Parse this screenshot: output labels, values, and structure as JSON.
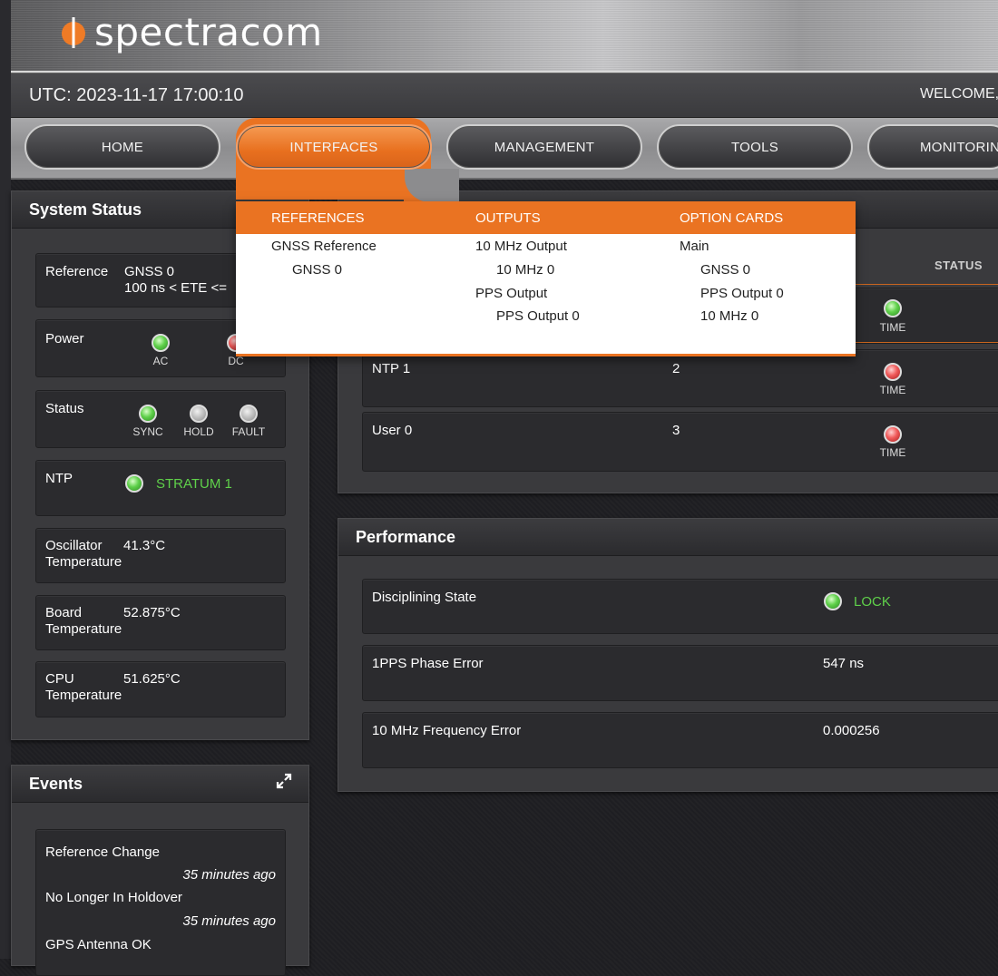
{
  "header": {
    "logo_text": "spectracom"
  },
  "utc_bar": {
    "utc": "UTC: 2023-11-17 17:00:10",
    "welcome": "WELCOME,"
  },
  "nav": {
    "items": [
      {
        "label": "HOME"
      },
      {
        "label": "INTERFACES",
        "active": true
      },
      {
        "label": "MANAGEMENT"
      },
      {
        "label": "TOOLS"
      },
      {
        "label": "MONITORIN"
      }
    ]
  },
  "dropdown": {
    "columns": [
      {
        "title": "REFERENCES",
        "items": [
          "GNSS Reference",
          "GNSS 0"
        ]
      },
      {
        "title": "OUTPUTS",
        "items": [
          "10 MHz Output",
          "10 MHz 0",
          "PPS Output",
          "PPS Output 0"
        ]
      },
      {
        "title": "OPTION CARDS",
        "items": [
          "Main",
          "GNSS 0",
          "PPS Output 0",
          "10 MHz 0"
        ]
      }
    ]
  },
  "system_status": {
    "title": "System Status",
    "reference": {
      "label": "Reference",
      "value": "GNSS 0",
      "detail": "100 ns < ETE <= "
    },
    "power": {
      "label": "Power",
      "leds": [
        "AC",
        "DC"
      ]
    },
    "status": {
      "label": "Status",
      "leds": [
        "SYNC",
        "HOLD",
        "FAULT"
      ]
    },
    "ntp": {
      "label": "NTP",
      "value": "STRATUM 1"
    },
    "oscillator": {
      "label1": "Oscillator",
      "label2": "Temperature",
      "value": "41.3°C"
    },
    "board": {
      "label1": "Board",
      "label2": "Temperature",
      "value": "52.875°C"
    },
    "cpu": {
      "label1": "CPU",
      "label2": "Temperature",
      "value": "51.625°C"
    }
  },
  "references_table": {
    "status_header": "STATUS",
    "rows": [
      {
        "name": "",
        "priority": "",
        "status": "TIME",
        "color": "green"
      },
      {
        "name": "NTP 1",
        "priority": "2",
        "status": "TIME",
        "color": "red"
      },
      {
        "name": "User 0",
        "priority": "3",
        "status": "TIME",
        "color": "red"
      }
    ]
  },
  "performance": {
    "title": "Performance",
    "rows": [
      {
        "label": "Disciplining State",
        "value": "LOCK"
      },
      {
        "label": "1PPS Phase Error",
        "value": "547 ns"
      },
      {
        "label": "10 MHz Frequency Error",
        "value": "0.000256"
      }
    ]
  },
  "events": {
    "title": "Events",
    "items": [
      {
        "text": "Reference Change",
        "time": "35 minutes ago"
      },
      {
        "text": "No Longer In Holdover",
        "time": "35 minutes ago"
      },
      {
        "text": "GPS Antenna OK",
        "time": ""
      }
    ]
  },
  "colors": {
    "accent": "#ea7322",
    "ok": "#5fd14a",
    "alarm": "#f05a5a"
  }
}
